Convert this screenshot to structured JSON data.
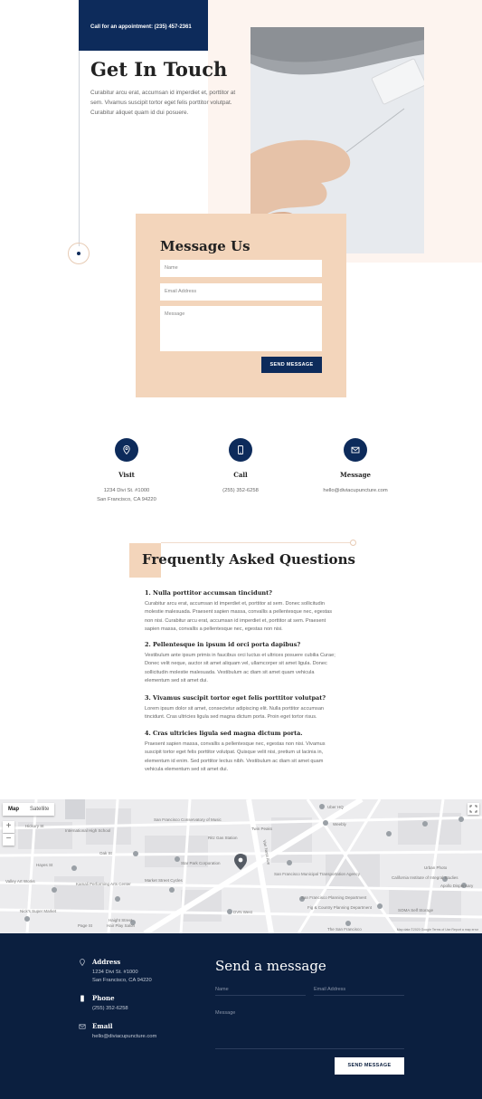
{
  "hero": {
    "appointment": "Call for an appointment: (235) 457-2361",
    "title": "Get In Touch",
    "intro": "Curabitur arcu erat, accumsan id imperdiet et, porttitor at sem. Vivamus suscipit tortor eget felis porttitor volutpat. Curabitur aliquet quam id dui posuere."
  },
  "form": {
    "title": "Message Us",
    "name_placeholder": "Name",
    "email_placeholder": "Email Address",
    "message_placeholder": "Message",
    "submit": "SEND MESSAGE"
  },
  "contact": [
    {
      "title": "Visit",
      "line1": "1234 Divi St. #1000",
      "line2": "San Francisco, CA 94220",
      "icon": "map-pin-icon"
    },
    {
      "title": "Call",
      "line1": "(255) 352-6258",
      "line2": "",
      "icon": "phone-icon"
    },
    {
      "title": "Message",
      "line1": "hello@diviacupuncture.com",
      "line2": "",
      "icon": "mail-icon"
    }
  ],
  "faq": {
    "title": "Frequently Asked Questions",
    "items": [
      {
        "q": "1. Nulla porttitor accumsan tincidunt?",
        "a": "Curabitur arcu erat, accumsan id imperdiet et, porttitor at sem. Donec sollicitudin molestie malesuada. Praesent sapien massa, convallis a pellentesque nec, egestas non nisi. Curabitur arcu erat, accumsan id imperdiet et, porttitor at sem. Praesent sapien massa, convallis a pellentesque nec, egestas non nisi."
      },
      {
        "q": "2. Pellentesque in ipsum id orci porta dapibus?",
        "a": "Vestibulum ante ipsum primis in faucibus orci luctus et ultrices posuere cubilia Curae; Donec velit neque, auctor sit amet aliquam vel, ullamcorper sit amet ligula. Donec sollicitudin molestie malesuada. Vestibulum ac diam sit amet quam vehicula elementum sed sit amet dui."
      },
      {
        "q": "3. Vivamus suscipit tortor eget felis porttitor volutpat?",
        "a": "Lorem ipsum dolor sit amet, consectetur adipiscing elit. Nulla porttitor accumsan tincidunt. Cras ultricies ligula sed magna dictum porta. Proin eget tortor risus."
      },
      {
        "q": "4. Cras ultricies ligula sed magna dictum porta.",
        "a": "Praesent sapien massa, convallis a pellentesque nec, egestas non nisi. Vivamus suscipit tortor eget felis porttitor volutpat. Quisque velit nisi, pretium ut lacinia in, elementum id enim. Sed porttitor lectus nibh. Vestibulum ac diam sit amet quam vehicula elementum sed sit amet dui."
      }
    ]
  },
  "map": {
    "tab_map": "Map",
    "tab_satellite": "Satellite",
    "zoom_in": "+",
    "zoom_out": "−",
    "footer": "Map data ©2020 Google   Terms of Use   Report a map error",
    "labels": [
      "Hickory St",
      "International High School",
      "San Francisco Conservatory of Music",
      "Twin Peaks",
      "Ritz Gas Station",
      "Oak St",
      "Hayes St",
      "Van Ness Ave",
      "Weebly",
      "Uber HQ",
      "Market Street Cycles",
      "San Francisco Planning Department",
      "SOMA Self Storage",
      "California Institute of Integral Studies",
      "Apollo Dispensary",
      "Urban Photo",
      "The San Francisco",
      "Nick's Super Market",
      "Haight Street",
      "Page St",
      "Hair Play Salon",
      "Star Park Corporation",
      "DVN West",
      "San Francisco Municipal Transportation Agency",
      "Fig & Country Planning Department",
      "Valley Art Works",
      "Kamali Performing Arts Center"
    ]
  },
  "footer": {
    "address_title": "Address",
    "address_line1": "1234 Divi St. #1000",
    "address_line2": "San Francisco, CA 94220",
    "phone_title": "Phone",
    "phone": "(255) 352-6258",
    "email_title": "Email",
    "email": "hello@diviacupuncture.com",
    "form_title": "Send a message",
    "name_placeholder": "Name",
    "email_placeholder": "Email Address",
    "message_placeholder": "Message",
    "submit": "SEND MESSAGE"
  },
  "colors": {
    "navy": "#0d2b5b",
    "peach": "#f3d5bb",
    "footer": "#0b1f3f"
  }
}
